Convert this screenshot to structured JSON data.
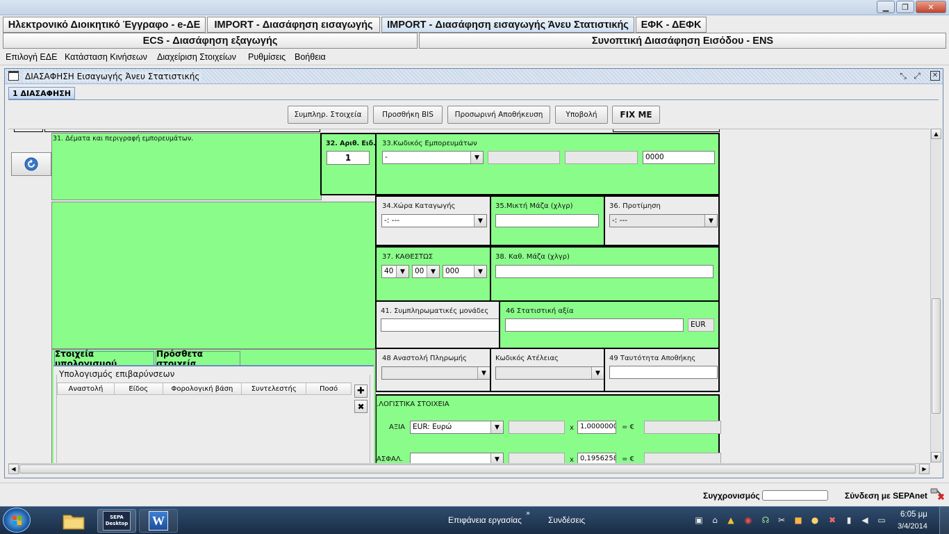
{
  "window_controls": {
    "minimize": "▁",
    "maximize": "❐",
    "close": "✕"
  },
  "module_tabs": [
    {
      "label": "Ηλεκτρονικό Διοικητικό Έγγραφο - e-ΔΕ"
    },
    {
      "label": "IMPORT - Διασάφηση εισαγωγής"
    },
    {
      "label": "IMPORT - Διασάφηση εισαγωγής Άνευ Στατιστικής"
    },
    {
      "label": "ΕΦΚ - ΔΕΦΚ"
    },
    {
      "label": "ECS - Διασάφηση εξαγωγής"
    },
    {
      "label": "Συνοπτική Διασάφηση Εισόδου - ENS"
    }
  ],
  "menu": [
    "Επιλογή ΕΔΕ",
    "Κατάσταση Κινήσεων",
    "Διαχείριση Στοιχείων",
    "Ρυθμίσεις",
    "Βοήθεια"
  ],
  "frame": {
    "title": "ΔΙΑΣΑΦΗΣΗ Εισαγωγής Άνευ Στατιστικής",
    "subtab": "1 ΔΙΑΣΑΦΗΣΗ",
    "buttons": {
      "complete": "Συμπληρ. Στοιχεία",
      "add_bis": "Προσθήκη BIS",
      "temp_save": "Προσωρινή Αποθήκευση",
      "submit": "Υποβολή",
      "fix": "FIX ME"
    }
  },
  "form": {
    "box31_label": "31. Δέματα και περιγραφή εμπορευμάτων.",
    "box32_label": "32. Αριθ. Ειδ.",
    "box32_value": "1",
    "box33_label": "33.Κωδικός Εμπορευμάτων",
    "box33_combo": "-",
    "box33_last": "0000",
    "box34_label": "34.Χώρα Καταγωγής",
    "box34_value": "-: ---",
    "box35_label": "35.Μικτή Μάζα (χλγρ)",
    "box36_label": "36. Προτίμηση",
    "box36_value": "-: ---",
    "box37_label": "37. ΚΑΘΕΣΤΩΣ",
    "box37_v1": "40",
    "box37_v2": "00",
    "box37_v3": "000",
    "box38_label": "38. Καθ. Μάζα (χλγρ)",
    "box41_label": "41. Συμπληρωματικές μονάδες",
    "box46_label": "46 Στατιστική αξία",
    "box46_currency": "EUR",
    "box48_label": "48 Αναστολή Πληρωμής",
    "atel_label": "Κωδικός Ατέλειας",
    "box49_label": "49 Ταυτότητα Αποθήκης",
    "logist_label": ".ΛΟΓΙΣΤΙΚΑ ΣΤΟΙΧΕΙΑ",
    "axia_label": "ΑΞΙΑ",
    "axia_currency": "EUR: Ευρώ",
    "axia_x": "x",
    "axia_rate": "1,0000000(",
    "axia_eq": "= €",
    "asfal_label": "ΑΣΦΑΛ.",
    "asfal_x": "x",
    "asfal_rate": "0,1956258(",
    "asfal_eq": "= €"
  },
  "calc": {
    "tabs": [
      "Στοιχεία υπολογισμού",
      "Πρόσθετα στοιχεία"
    ],
    "group_title": "Υπολογισμός επιβαρύνσεων",
    "columns": [
      "Αναστολή",
      "Είδος",
      "Φορολογική βάση",
      "Συντελεστής",
      "Ποσό"
    ]
  },
  "status": {
    "sync_label": "Συγχρονισμός",
    "sepa_label": "Σύνδεση με SEPAnet"
  },
  "taskbar": {
    "desktop_label": "Επιφάνεια εργασίας",
    "links_label": "Συνδέσεις",
    "sepa_icon_text": "SEPA Desktop",
    "word_icon_text": "W",
    "time": "6:05 μμ",
    "date": "3/4/2014"
  },
  "colors": {
    "form_green": "#8afc8a",
    "titlebar": "#c4d4e8",
    "taskbar": "#1a2d45"
  }
}
